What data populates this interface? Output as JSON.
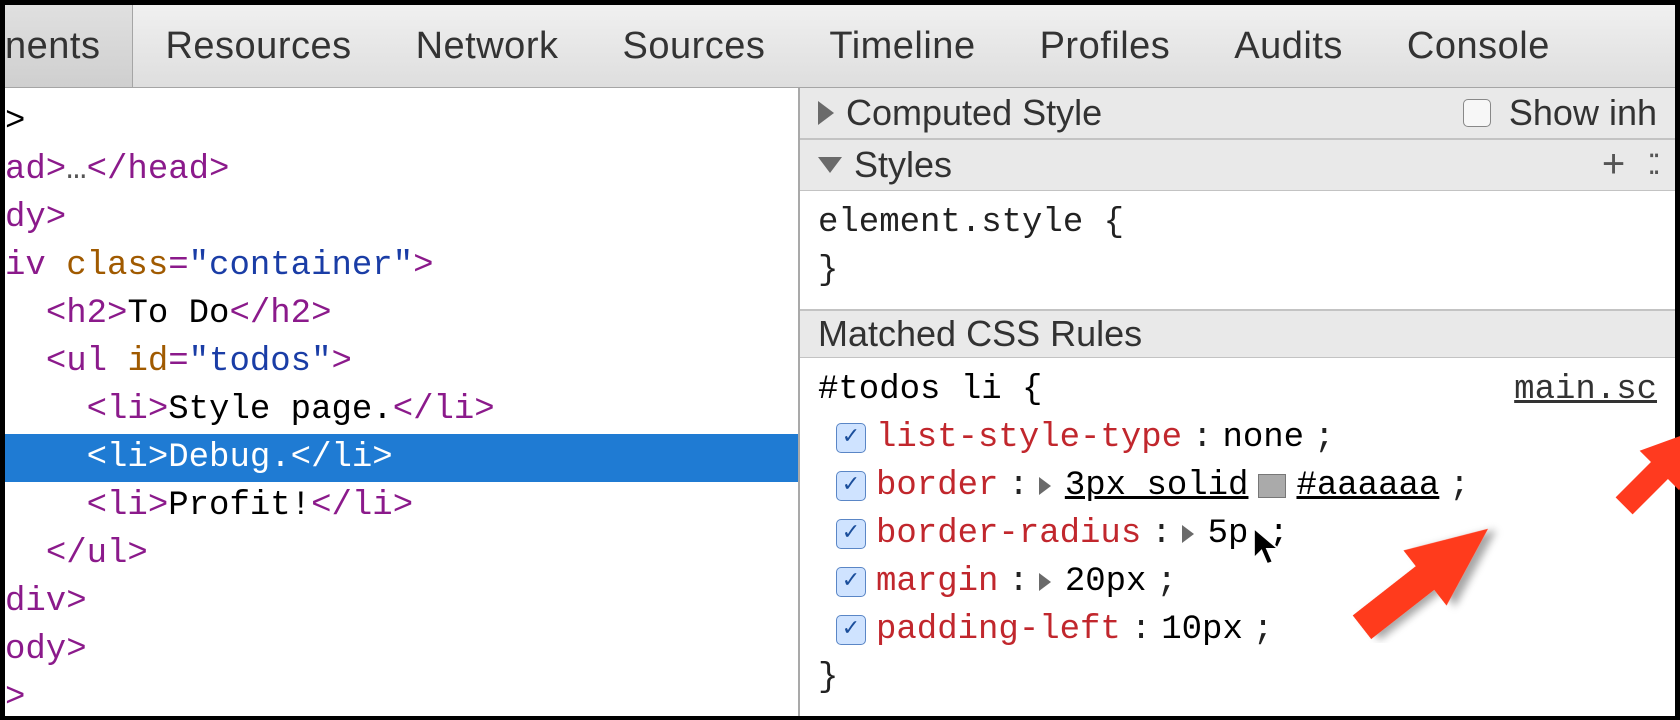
{
  "toolbar": {
    "tabs": [
      {
        "label": "nents",
        "active": true
      },
      {
        "label": "Resources"
      },
      {
        "label": "Network"
      },
      {
        "label": "Sources"
      },
      {
        "label": "Timeline"
      },
      {
        "label": "Profiles"
      },
      {
        "label": "Audits"
      },
      {
        "label": "Console"
      }
    ]
  },
  "dom": {
    "lines": [
      {
        "indent": 0,
        "segments": [
          {
            "t": "text",
            "v": ">"
          }
        ]
      },
      {
        "indent": 0,
        "segments": [
          {
            "t": "tag",
            "v": "ad>"
          },
          {
            "t": "ellip",
            "v": "…"
          },
          {
            "t": "tag",
            "v": "</head>"
          }
        ]
      },
      {
        "indent": 0,
        "segments": [
          {
            "t": "tag",
            "v": "dy>"
          }
        ]
      },
      {
        "indent": 0,
        "segments": [
          {
            "t": "tag",
            "v": "iv "
          },
          {
            "t": "attr-name",
            "v": "class"
          },
          {
            "t": "tag",
            "v": "="
          },
          {
            "t": "attr-val",
            "v": "\"container\""
          },
          {
            "t": "tag",
            "v": ">"
          }
        ]
      },
      {
        "indent": 1,
        "segments": [
          {
            "t": "tag",
            "v": "<h2>"
          },
          {
            "t": "text",
            "v": "To Do"
          },
          {
            "t": "tag",
            "v": "</h2>"
          }
        ]
      },
      {
        "indent": 1,
        "segments": [
          {
            "t": "tag",
            "v": "<ul "
          },
          {
            "t": "attr-name",
            "v": "id"
          },
          {
            "t": "tag",
            "v": "="
          },
          {
            "t": "attr-val",
            "v": "\"todos\""
          },
          {
            "t": "tag",
            "v": ">"
          }
        ]
      },
      {
        "indent": 2,
        "segments": [
          {
            "t": "tag",
            "v": "<li>"
          },
          {
            "t": "text",
            "v": "Style page."
          },
          {
            "t": "tag",
            "v": "</li>"
          }
        ]
      },
      {
        "indent": 2,
        "selected": true,
        "segments": [
          {
            "t": "tag",
            "v": "<li>"
          },
          {
            "t": "text",
            "v": "Debug."
          },
          {
            "t": "tag",
            "v": "</li>"
          }
        ]
      },
      {
        "indent": 2,
        "segments": [
          {
            "t": "tag",
            "v": "<li>"
          },
          {
            "t": "text",
            "v": "Profit!"
          },
          {
            "t": "tag",
            "v": "</li>"
          }
        ]
      },
      {
        "indent": 1,
        "segments": [
          {
            "t": "tag",
            "v": "</ul>"
          }
        ]
      },
      {
        "indent": 0,
        "segments": [
          {
            "t": "tag",
            "v": "div>"
          }
        ]
      },
      {
        "indent": 0,
        "segments": [
          {
            "t": "tag",
            "v": "ody>"
          }
        ]
      },
      {
        "indent": 0,
        "segments": [
          {
            "t": "tag",
            "v": ">"
          }
        ]
      }
    ]
  },
  "styles": {
    "computed": {
      "title": "Computed Style",
      "show_inherited_label": "Show inh"
    },
    "styles_header": "Styles",
    "element_style": {
      "selector": "element.style {",
      "close": "}"
    },
    "matched_header": "Matched CSS Rules",
    "rule": {
      "selector": "#todos li {",
      "source": "main.sc",
      "declarations": [
        {
          "prop": "list-style-type",
          "value_parts": [
            {
              "t": "plain",
              "v": " none"
            }
          ],
          "expand": false
        },
        {
          "prop": "border",
          "value_parts": [
            {
              "t": "tri"
            },
            {
              "t": "u",
              "v": "3px solid "
            },
            {
              "t": "swatch"
            },
            {
              "t": "u",
              "v": "#aaaaaa"
            }
          ],
          "expand": false
        },
        {
          "prop": "border-radius",
          "value_parts": [
            {
              "t": "tri"
            },
            {
              "t": "plain",
              "v": "5p"
            },
            {
              "t": "cursor"
            },
            {
              "t": "plain",
              "v": ";"
            }
          ],
          "expand": false,
          "cursor_row": true
        },
        {
          "prop": "margin",
          "value_parts": [
            {
              "t": "tri"
            },
            {
              "t": "plain",
              "v": "20px"
            }
          ],
          "expand": false
        },
        {
          "prop": "padding-left",
          "value_parts": [
            {
              "t": "plain",
              "v": " 10px"
            }
          ],
          "expand": false
        }
      ],
      "close": "}"
    }
  }
}
